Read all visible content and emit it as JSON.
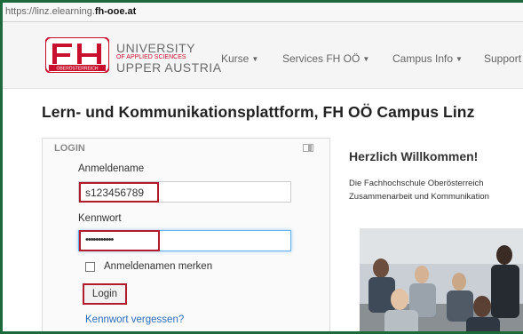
{
  "browser": {
    "url_prefix": "https://linz.elearning.",
    "url_domain": "fh-ooe.at"
  },
  "brand": {
    "logo_small_text": "OBERÖSTERREICH",
    "line1": "UNIVERSITY",
    "line2": "OF APPLIED SCIENCES",
    "line3": "UPPER AUSTRIA",
    "red": "#c8102e"
  },
  "nav": [
    {
      "label": "Kurse"
    },
    {
      "label": "Services FH OÖ"
    },
    {
      "label": "Campus Info"
    },
    {
      "label": "Support"
    }
  ],
  "page_title": "Lern- und Kommunikationsplattform, FH OÖ Campus Linz",
  "login": {
    "title": "LOGIN",
    "username_label": "Anmeldename",
    "username_value": "s123456789",
    "password_label": "Kennwort",
    "password_value": "•••••••••••",
    "remember_label": "Anmeldenamen merken",
    "login_button": "Login",
    "forgot_link": "Kennwort vergessen?"
  },
  "welcome": {
    "heading": "Herzlich Willkommen!",
    "line1": "Die Fachhochschule Oberösterreich",
    "line2": "Zusammenarbeit und Kommunikation"
  },
  "colors": {
    "highlight_red": "#b01c2e",
    "link_blue": "#2a6ebb",
    "frame_green": "#1d6a3a"
  }
}
